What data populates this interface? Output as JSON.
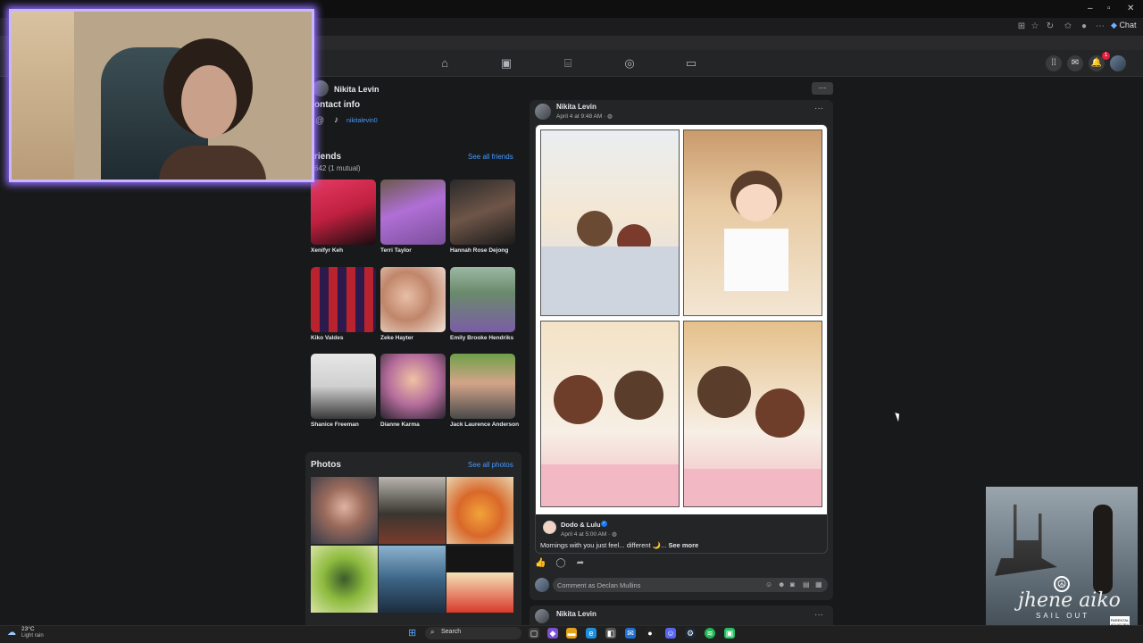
{
  "fb_header": {
    "profile_name": "Nikita Levin",
    "nav_icons": [
      "home-icon",
      "calendar-icon",
      "marketplace-icon",
      "groups-icon",
      "gaming-icon"
    ],
    "right_icons": [
      "menu-grid-icon",
      "messenger-icon",
      "bell-icon"
    ],
    "notification_count": "1"
  },
  "browser": {
    "chat_label": "Chat"
  },
  "contact": {
    "title": "ontact info",
    "at_symbol": "@",
    "tiktok": "nikitalevin0"
  },
  "friends": {
    "title": "riends",
    "count": "642 (1 mutual)",
    "see_all": "See all friends",
    "list": [
      {
        "name": "Xenifyr Keh"
      },
      {
        "name": "Terri Taylor"
      },
      {
        "name": "Hannah Rose Dejong"
      },
      {
        "name": "Kiko Valdes"
      },
      {
        "name": "Zeke Hayter"
      },
      {
        "name": "Emily Brooke Hendriks"
      },
      {
        "name": "Shanice Freeman"
      },
      {
        "name": "Dianne Karma"
      },
      {
        "name": "Jack Laurence Anderson"
      }
    ]
  },
  "photos": {
    "title": "Photos",
    "see_all": "See all photos"
  },
  "post": {
    "author": "Nikita Levin",
    "time": "April 4 at 9:48 AM · ",
    "more": "···",
    "shared": {
      "author": "Dodo & Lulu",
      "time": "April 4 at 5:00 AM · ",
      "caption": "Mornings with you just feel... different 🌙... ",
      "see_more": "See more"
    },
    "comment_placeholder": "Comment as Declan Mullins"
  },
  "next_post": {
    "author": "Nikita Levin",
    "more": "···"
  },
  "overlay": {
    "album_artist": "jhene aiko",
    "album_title": "SAIL OUT"
  },
  "taskbar": {
    "weather_temp": "23°C",
    "weather_desc": "Light rain",
    "search_label": "Search"
  },
  "colors": {
    "accent": "#4599ff",
    "background": "#18191a",
    "card": "#242526",
    "webcam_glow": "#8f6cff"
  }
}
